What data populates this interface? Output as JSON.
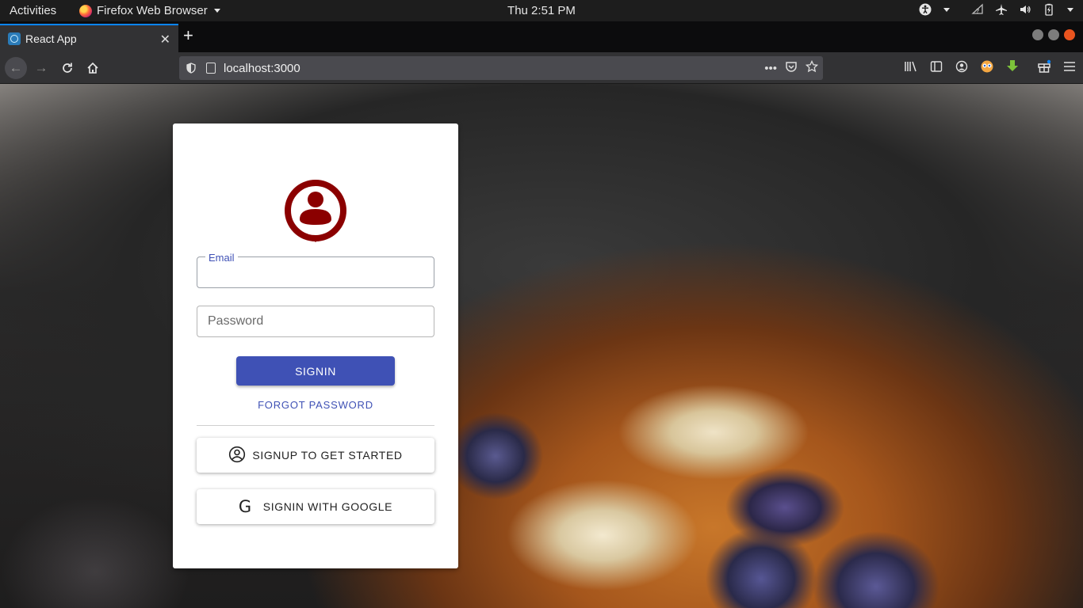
{
  "topbar": {
    "activities": "Activities",
    "app_name": "Firefox Web Browser",
    "clock": "Thu  2:51 PM"
  },
  "tab": {
    "title": "React App"
  },
  "navbar": {
    "url": "localhost:3000"
  },
  "login": {
    "email_label": "Email",
    "email_value": "",
    "password_placeholder": "Password",
    "signin_label": "SIGNIN",
    "forgot_label": "FORGOT PASSWORD",
    "signup_label": "SIGNUP TO GET STARTED",
    "google_label": "SIGNIN WITH GOOGLE",
    "google_icon_glyph": "G"
  },
  "colors": {
    "primary": "#3f51b5",
    "avatar": "#8b0000",
    "topbar": "#1d1d1d",
    "toolbar": "#323234"
  },
  "icons": [
    "firefox-icon",
    "accessibility-icon",
    "network-icon",
    "airplane-icon",
    "volume-icon",
    "battery-icon",
    "power-icon",
    "back-icon",
    "forward-icon",
    "reload-icon",
    "home-icon",
    "shield-icon",
    "page-icon",
    "more-icon",
    "pocket-icon",
    "bookmark-star-icon",
    "library-icon",
    "sidebar-icon",
    "account-icon",
    "extension-icon",
    "download-icon",
    "gift-icon",
    "menu-icon",
    "user-avatar-icon",
    "account-circle-icon",
    "google-icon"
  ]
}
